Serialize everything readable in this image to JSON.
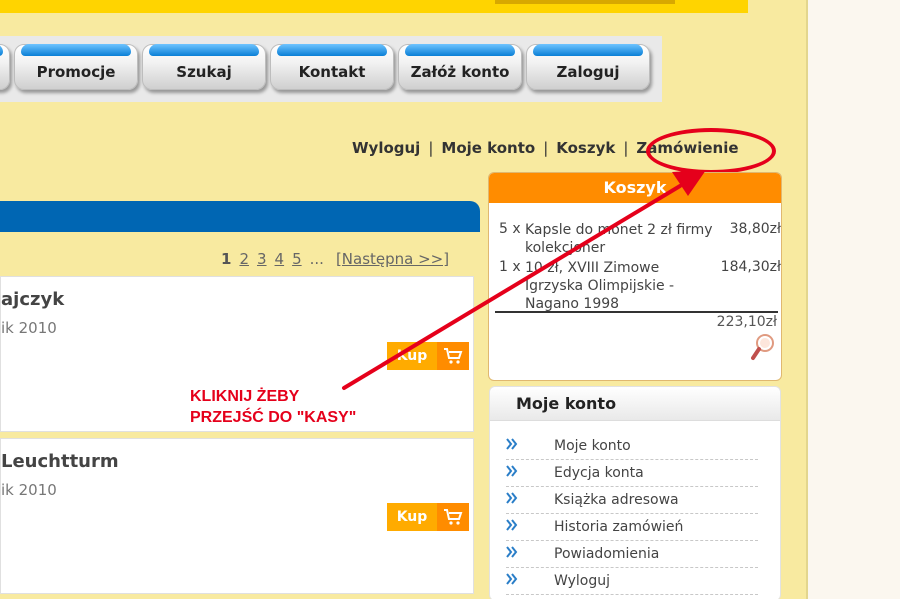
{
  "nav": {
    "tabs": [
      {
        "label": ""
      },
      {
        "label": "Promocje"
      },
      {
        "label": "Szukaj"
      },
      {
        "label": "Kontakt"
      },
      {
        "label": "Załóż konto"
      },
      {
        "label": "Zaloguj"
      }
    ]
  },
  "account_links": {
    "logout": "Wyloguj",
    "my_account": "Moje konto",
    "cart": "Koszyk",
    "order": "Zamówienie",
    "separator": "|"
  },
  "pagination": {
    "pages": [
      "1",
      "2",
      "3",
      "4",
      "5"
    ],
    "ellipsis": "...",
    "next": "[Następna >>]"
  },
  "products": [
    {
      "title": "ajczyk",
      "date": "ik 2010",
      "buy_label": "Kup"
    },
    {
      "title": "Leuchtturm",
      "date": "ik 2010",
      "buy_label": "Kup"
    }
  ],
  "cart": {
    "title": "Koszyk",
    "items": [
      {
        "qty": "5 x",
        "name": "Kapsle do monet 2 zł firmy kolekcjoner",
        "price": "38,80zł"
      },
      {
        "qty": "1 x",
        "name": "10 zł, XVIII Zimowe Igrzyska Olimpijskie - Nagano 1998",
        "price": "184,30zł"
      }
    ],
    "total": "223,10zł"
  },
  "account_box": {
    "title": "Moje konto",
    "items": [
      "Moje konto",
      "Edycja konta",
      "Książka adresowa",
      "Historia zamówień",
      "Powiadomienia",
      "Wyloguj"
    ]
  },
  "annotation": {
    "line1": "KLIKNIJ ŻEBY",
    "line2": "PRZEJŚĆ DO \"KASY\""
  },
  "icons": {
    "cart": "shopping-cart-icon",
    "magnifier": "magnifier-icon",
    "chevron": "double-chevron-right-icon"
  },
  "colors": {
    "page_bg": "#f8eaa0",
    "nav_cap": "#0a7fd6",
    "content_header": "#0066b3",
    "cart_header": "#ff8c00",
    "buy_button": "#ffab00",
    "annotation": "#e5001b"
  }
}
